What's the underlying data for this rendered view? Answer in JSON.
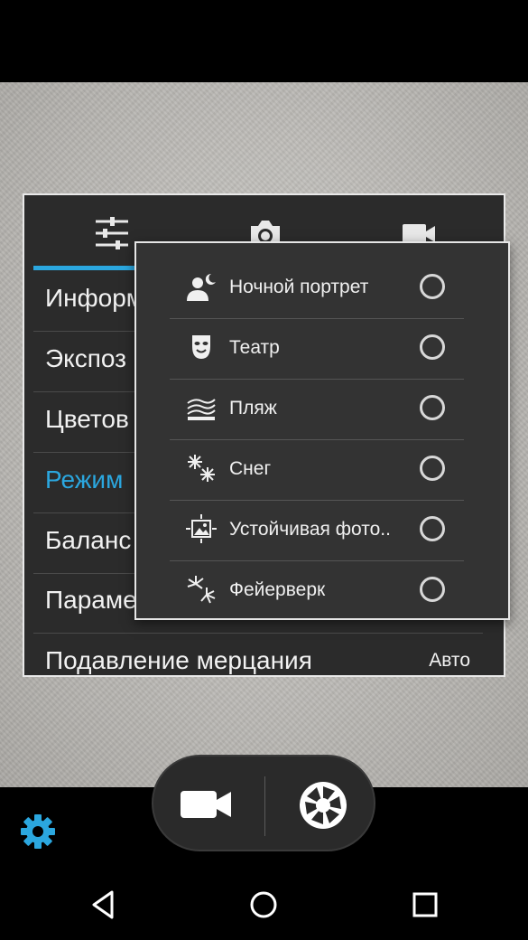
{
  "app": {
    "name": "Camera"
  },
  "colors": {
    "accent": "#2ba7df",
    "panel": "#2b2b2b",
    "popup": "#333333"
  },
  "settings_tabs": [
    {
      "name": "general-settings",
      "icon": "sliders-icon",
      "active": true
    },
    {
      "name": "photo-settings",
      "icon": "camera-icon",
      "active": false
    },
    {
      "name": "video-settings",
      "icon": "video-camera-icon",
      "active": false
    }
  ],
  "settings_rows": [
    {
      "label": "Информ",
      "active": false
    },
    {
      "label": "Экспоз",
      "active": false
    },
    {
      "label": "Цветов",
      "active": false
    },
    {
      "label": "Режим",
      "active": true
    },
    {
      "label": "Баланс",
      "active": false
    },
    {
      "label": "Параме",
      "active": false
    },
    {
      "label": "Подавление мерцания",
      "value": "Авто",
      "active": false
    }
  ],
  "scene_popup": {
    "items": [
      {
        "label": "Ночной портрет",
        "icon": "night-portrait-icon",
        "selected": false
      },
      {
        "label": "Театр",
        "icon": "theater-mask-icon",
        "selected": false
      },
      {
        "label": "Пляж",
        "icon": "beach-icon",
        "selected": false
      },
      {
        "label": "Снег",
        "icon": "snowflake-icon",
        "selected": false
      },
      {
        "label": "Устойчивая фото..",
        "icon": "steady-photo-icon",
        "selected": false
      },
      {
        "label": "Фейерверк",
        "icon": "fireworks-icon",
        "selected": false
      }
    ]
  },
  "controls": {
    "video_icon": "video-camera-icon",
    "shutter_icon": "shutter-icon",
    "settings_icon": "gear-icon"
  },
  "navigation": {
    "back": "back-icon",
    "home": "home-icon",
    "recents": "recents-icon"
  }
}
